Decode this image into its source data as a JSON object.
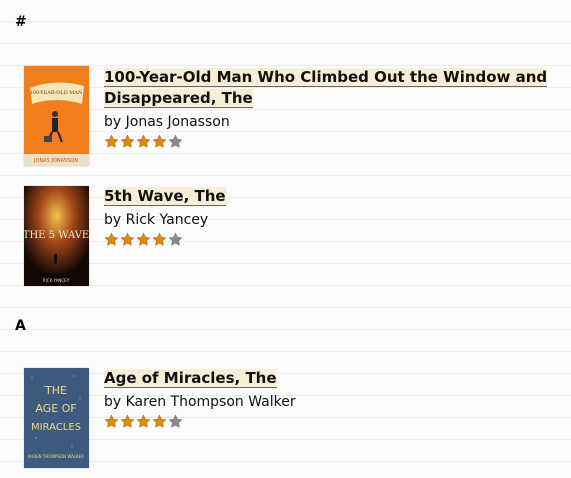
{
  "sections": [
    {
      "heading": "#",
      "books": [
        {
          "title": "100-Year-Old Man Who Climbed Out the Window and Disappeared, The",
          "author": "by Jonas Jonasson",
          "rating": 4,
          "max_rating": 5,
          "cover_text": "JONAS JONASSON"
        },
        {
          "title": "5th Wave, The",
          "author": "by Rick Yancey",
          "rating": 4,
          "max_rating": 5,
          "cover_text": "THE 5 WAVE"
        }
      ]
    },
    {
      "heading": "A",
      "books": [
        {
          "title": "Age of Miracles, The",
          "author": "by Karen Thompson Walker",
          "rating": 4,
          "max_rating": 5,
          "cover_text": "THE AGE OF MIRACLES"
        }
      ]
    }
  ],
  "colors": {
    "star_filled": "#d98a10",
    "star_empty": "#8a8a8a",
    "title_highlight": "#f6efd6"
  }
}
